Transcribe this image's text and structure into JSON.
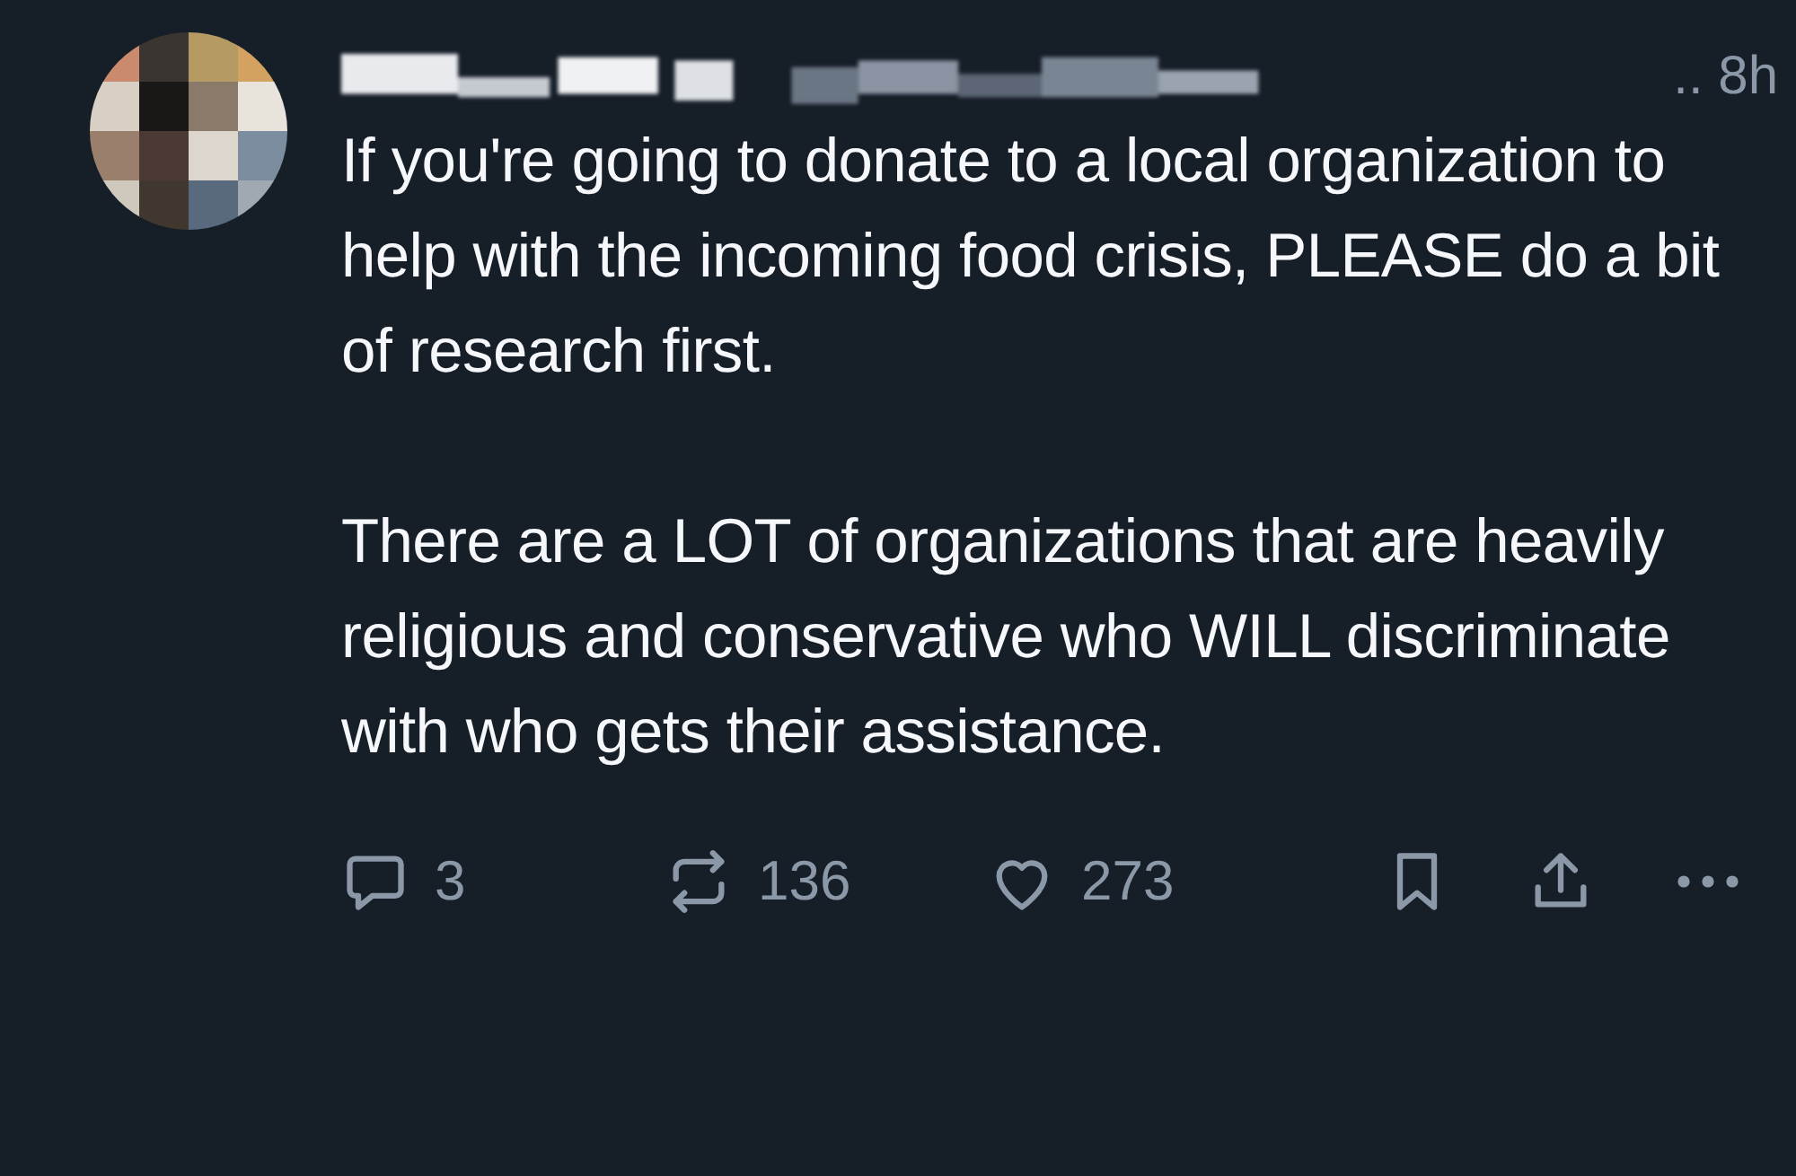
{
  "post": {
    "time": ".. 8h",
    "paragraphs": [
      "If you're going to donate to a local organization to help with the incoming food crisis, PLEASE do a bit of research first.",
      "There are a LOT of organizations that are heavily religious and conservative who WILL discriminate with who gets their assistance."
    ],
    "actions": [
      {
        "kind": "reply",
        "count": "3"
      },
      {
        "kind": "repost",
        "count": "136"
      },
      {
        "kind": "like",
        "count": "273"
      },
      {
        "kind": "bookmark"
      },
      {
        "kind": "share"
      },
      {
        "kind": "more"
      }
    ]
  }
}
